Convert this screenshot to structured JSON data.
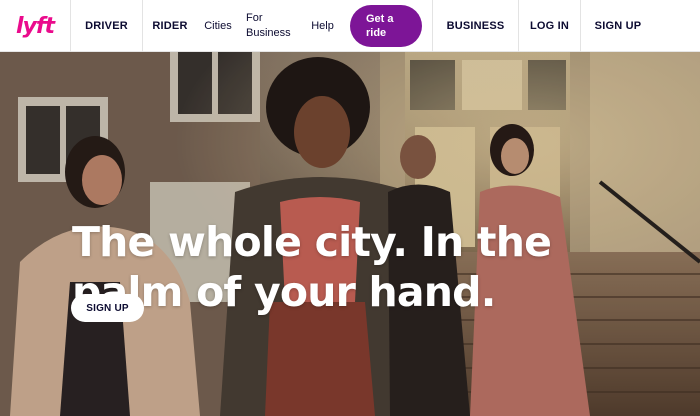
{
  "nav": {
    "logo": "lyft",
    "driver": "DRIVER",
    "rider": "RIDER",
    "cities": "Cities",
    "for_business": "For\nBusiness",
    "help": "Help",
    "get_ride": "Get a\nride",
    "business": "BUSINESS",
    "login": "LOG IN",
    "signup": "SIGN UP"
  },
  "hero": {
    "headline_line1": "The whole city. In the",
    "headline_line2": "palm of your hand.",
    "cta": "SIGN UP"
  },
  "colors": {
    "brand_pink": "#ea0b8c",
    "brand_purple": "#7d1597",
    "navy": "#0c0b31"
  }
}
